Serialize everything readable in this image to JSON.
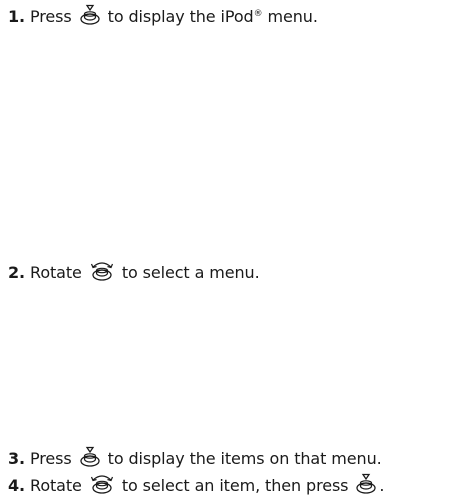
{
  "steps": [
    {
      "number": "1.",
      "before": "Press",
      "icon": "press-knob-icon",
      "after": "to display the iPod",
      "mark": "®",
      "after2": "menu."
    },
    {
      "number": "2.",
      "before": "Rotate",
      "icon": "rotate-knob-icon",
      "after": "to select a menu."
    },
    {
      "number": "3.",
      "before": "Press",
      "icon": "press-knob-icon",
      "after": "to display the items on that menu."
    },
    {
      "number": "4.",
      "before": "Rotate",
      "icon": "rotate-knob-icon",
      "after": "to select an item, then press",
      "icon2": "press-knob-icon",
      "end": "."
    }
  ]
}
